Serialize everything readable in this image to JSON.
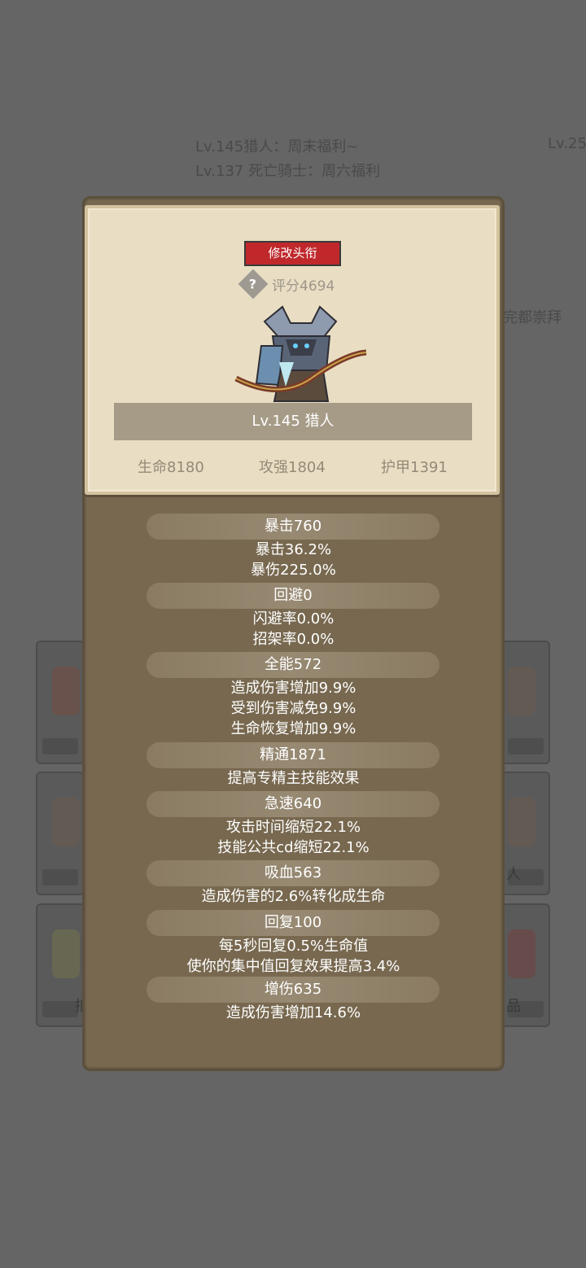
{
  "background": {
    "lines": [
      "Lv.145猎人：周末福利~",
      "Lv.137 死亡骑士：周六福利",
      "Lv.25",
      "完都崇拜"
    ],
    "card_labels": [
      "人",
      "品",
      "抵"
    ]
  },
  "panel": {
    "edit_title_button": "修改头衔",
    "score": "评分4694",
    "hero_icon": "hunter-character-icon",
    "name_level": "Lv.145 猎人",
    "base_stats": {
      "hp": "生命8180",
      "atk": "攻强1804",
      "armor": "护甲1391"
    },
    "sections": [
      {
        "title": "暴击760",
        "lines": [
          "暴击36.2%",
          "暴伤225.0%"
        ]
      },
      {
        "title": "回避0",
        "lines": [
          "闪避率0.0%",
          "招架率0.0%"
        ]
      },
      {
        "title": "全能572",
        "lines": [
          "造成伤害增加9.9%",
          "受到伤害减免9.9%",
          "生命恢复增加9.9%"
        ]
      },
      {
        "title": "精通1871",
        "lines": [
          "提高专精主技能效果"
        ]
      },
      {
        "title": "急速640",
        "lines": [
          "攻击时间缩短22.1%",
          "技能公共cd缩短22.1%"
        ]
      },
      {
        "title": "吸血563",
        "lines": [
          "造成伤害的2.6%转化成生命"
        ]
      },
      {
        "title": "回复100",
        "lines": [
          "每5秒回复0.5%生命值",
          "使你的集中值回复效果提高3.4%"
        ]
      },
      {
        "title": "增伤635",
        "lines": [
          "造成伤害增加14.6%"
        ]
      }
    ]
  },
  "colors": {
    "edit_button": "#c0282c",
    "parchment": "#e9dec3",
    "panel": "#77684f",
    "overlay": "#656565"
  }
}
